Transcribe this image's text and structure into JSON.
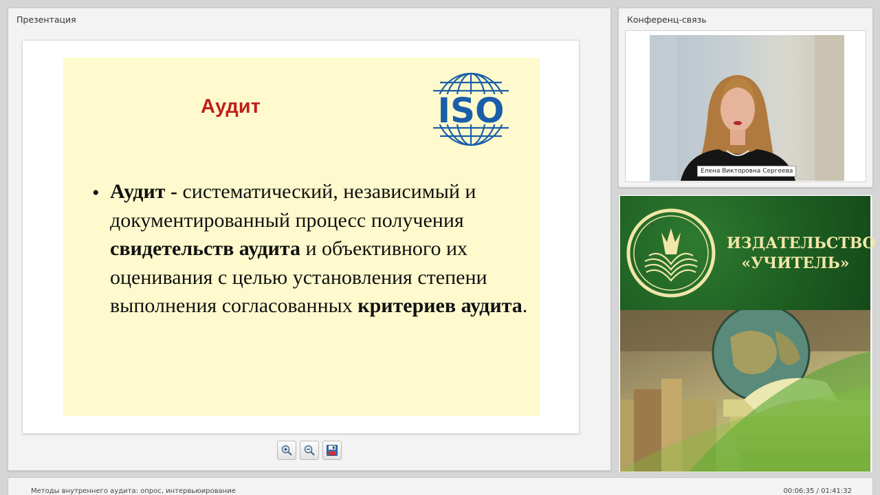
{
  "presentation": {
    "panel_title": "Презентация",
    "slide": {
      "heading": "Аудит",
      "logo_text": "ISO",
      "bullet": "•",
      "text_parts": [
        {
          "text": "Аудит -",
          "bold": true
        },
        {
          "text": " систематический, независимый и документированный процесс получения ",
          "bold": false
        },
        {
          "text": "свидетельств аудита",
          "bold": true
        },
        {
          "text": " и объективного их оценивания с целью установления степени выполнения согласованных ",
          "bold": false
        },
        {
          "text": "критериев аудита",
          "bold": true
        },
        {
          "text": ".",
          "bold": false
        }
      ]
    },
    "toolbar": [
      {
        "name": "zoom-in-button",
        "icon": "zoom-in-icon"
      },
      {
        "name": "zoom-out-button",
        "icon": "zoom-out-icon"
      },
      {
        "name": "save-button",
        "icon": "floppy-disk-icon"
      }
    ]
  },
  "conference": {
    "panel_title": "Конференц-связь",
    "speaker_name": "Елена Викторовна Сергеева"
  },
  "ad": {
    "title_line1": "ИЗДАТЕЛЬСТВО",
    "title_line2": "«УЧИТЕЛЬ»"
  },
  "footer": {
    "lecture_title": "Методы внутреннего аудита: опрос, интервьюирование",
    "time": "00:06:35 / 01:41:32"
  },
  "colors": {
    "slide_background": "#fffacd",
    "heading": "#c0201b",
    "iso_blue": "#1a5ea8",
    "publisher_green": "#1c5c21",
    "publisher_gold": "#f1e7a8"
  }
}
